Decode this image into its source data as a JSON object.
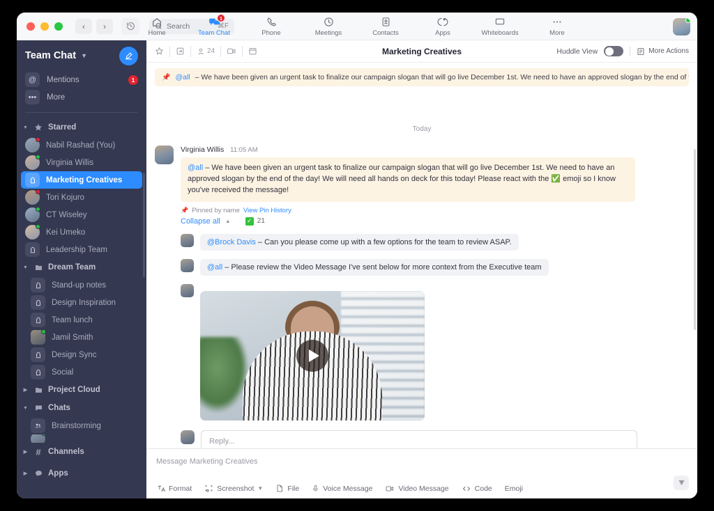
{
  "window": {
    "traffic_lights": [
      "close",
      "minimize",
      "maximize"
    ],
    "back_label": "‹",
    "forward_label": "›",
    "search": {
      "placeholder": "Search",
      "shortcut": "⌘F"
    }
  },
  "mainnav": {
    "items": [
      {
        "label": "Home",
        "icon": "home-icon",
        "active": false,
        "badge": ""
      },
      {
        "label": "Team Chat",
        "icon": "chat-bubbles-icon",
        "active": true,
        "badge": "1"
      },
      {
        "label": "Phone",
        "icon": "phone-icon",
        "active": false,
        "badge": ""
      },
      {
        "label": "Meetings",
        "icon": "clock-icon",
        "active": false,
        "badge": ""
      },
      {
        "label": "Contacts",
        "icon": "contact-card-icon",
        "active": false,
        "badge": ""
      },
      {
        "label": "Apps",
        "icon": "apps-icon",
        "active": false,
        "badge": ""
      },
      {
        "label": "Whiteboards",
        "icon": "whiteboard-icon",
        "active": false,
        "badge": ""
      },
      {
        "label": "More",
        "icon": "ellipsis-icon",
        "active": false,
        "badge": ""
      }
    ]
  },
  "sidebar": {
    "title": "Team Chat",
    "compose_label": "compose-icon",
    "quick": [
      {
        "label": "Mentions",
        "icon": "at-icon",
        "count": "1"
      },
      {
        "label": "More",
        "icon": "ellipsis-icon",
        "count": ""
      }
    ],
    "sections": [
      {
        "label": "Starred",
        "icon": "star-icon",
        "expanded": true,
        "items": [
          {
            "label": "Nabil Rashad (You)",
            "type": "avatar",
            "presence": "busy",
            "selected": false
          },
          {
            "label": "Virginia Willis",
            "type": "avatar",
            "presence": "on",
            "selected": false
          },
          {
            "label": "Marketing Creatives",
            "type": "lock",
            "presence": "",
            "selected": true
          },
          {
            "label": "Tori Kojuro",
            "type": "avatar",
            "presence": "busy",
            "selected": false
          },
          {
            "label": "CT Wiseley",
            "type": "avatar",
            "presence": "on",
            "selected": false
          },
          {
            "label": "Kei Umeko",
            "type": "avatar",
            "presence": "on",
            "selected": false
          },
          {
            "label": "Leadership Team",
            "type": "lock",
            "presence": "",
            "selected": false
          }
        ]
      },
      {
        "label": "Dream Team",
        "icon": "folder-icon",
        "expanded": true,
        "items": [
          {
            "label": "Stand-up notes",
            "type": "lock",
            "presence": "",
            "selected": false
          },
          {
            "label": "Design Inspiration",
            "type": "lock",
            "presence": "",
            "selected": false
          },
          {
            "label": "Team lunch",
            "type": "lock",
            "presence": "",
            "selected": false
          },
          {
            "label": "Jamil Smith",
            "type": "avatar",
            "presence": "sq",
            "selected": false
          },
          {
            "label": "Design Sync",
            "type": "lock",
            "presence": "",
            "selected": false
          },
          {
            "label": "Social",
            "type": "lock",
            "presence": "",
            "selected": false
          }
        ]
      },
      {
        "label": "Project Cloud",
        "icon": "folder-icon",
        "expanded": false,
        "items": []
      },
      {
        "label": "Chats",
        "icon": "chat-icon",
        "expanded": true,
        "items": [
          {
            "label": "Brainstorming",
            "type": "group",
            "presence": "",
            "selected": false
          }
        ]
      },
      {
        "label": "Channels",
        "icon": "hash-icon",
        "expanded": false,
        "items": []
      },
      {
        "label": "Apps",
        "icon": "app-chat-icon",
        "expanded": false,
        "items": []
      }
    ]
  },
  "chat_header": {
    "title": "Marketing Creatives",
    "icons": [
      {
        "name": "star-icon",
        "label": ""
      },
      {
        "name": "share-screen-icon",
        "label": ""
      },
      {
        "name": "members-icon",
        "label": "24"
      },
      {
        "name": "video-icon",
        "label": ""
      },
      {
        "name": "calendar-icon",
        "label": ""
      }
    ],
    "huddle_label": "Huddle View",
    "huddle_on": false,
    "more_actions_label": "More Actions"
  },
  "pinned_banner": {
    "mention": "@all",
    "text": "– We have been given an urgent task to finalize our campaign slogan that will go live December 1st. We need to have an approved slogan by the end of the day! We …"
  },
  "conversation": {
    "day_divider": "Today",
    "message": {
      "author": "Virginia Willis",
      "time": "11:05 AM",
      "mention": "@all",
      "text": "– We have been given an urgent task to finalize our campaign slogan that will go live December 1st. We need to have an approved slogan by the end of the day! We will need all hands on deck for this today! Please react with the ✅ emoji so I know you've received the message!",
      "pinned_by": "Pinned by name",
      "pin_history_link": "View Pin History",
      "collapse_label": "Collapse all",
      "reaction_emoji": "✓",
      "reaction_count": "21"
    },
    "replies": [
      {
        "mention": "@Brock Davis",
        "text": "– Can you please come up with a few options for the team to review ASAP."
      },
      {
        "mention": "@all",
        "text": "– Please review the Video Message I've sent below for more context from the Executive team"
      }
    ],
    "video": {
      "play_label": "play-button",
      "alt": "video-message-thumbnail"
    },
    "reply_box": {
      "placeholder": "Reply...",
      "tools": [
        "format-icon",
        "screenshot-icon",
        "file-icon",
        "voice-message-icon",
        "video-message-icon",
        "code-icon",
        "emoji-icon"
      ],
      "send_label": "send-icon"
    }
  },
  "composer": {
    "placeholder": "Message Marketing Creatives",
    "tools": [
      {
        "label": "Format",
        "icon": "format-icon",
        "caret": false
      },
      {
        "label": "Screenshot",
        "icon": "screenshot-icon",
        "caret": true
      },
      {
        "label": "File",
        "icon": "file-icon",
        "caret": false
      },
      {
        "label": "Voice Message",
        "icon": "microphone-icon",
        "caret": false
      },
      {
        "label": "Video Message",
        "icon": "video-icon",
        "caret": false
      },
      {
        "label": "Code",
        "icon": "code-icon",
        "caret": false
      },
      {
        "label": "Emoji",
        "icon": "emoji-icon",
        "caret": false
      }
    ],
    "send_label": "send-icon"
  },
  "colors": {
    "accent": "#2d8cff",
    "sidebar_bg": "#343850",
    "badge_red": "#e8222e",
    "highlight_bg": "#fdf3e3",
    "reaction_green": "#34c13b"
  }
}
